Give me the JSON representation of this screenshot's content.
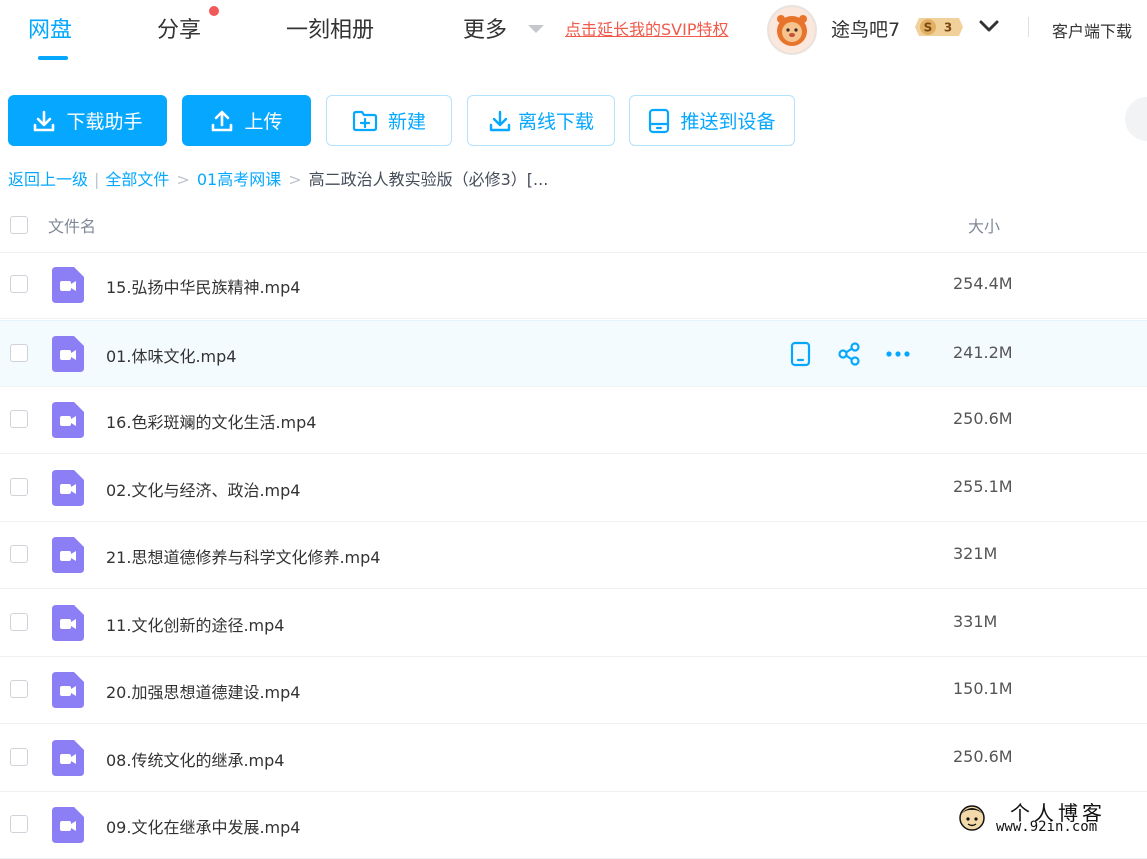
{
  "nav": {
    "tabs": [
      "网盘",
      "分享",
      "一刻相册",
      "更多"
    ],
    "svip_promo": "点击延长我的SVIP特权",
    "username": "途鸟吧7",
    "svip_level": "3",
    "svip_letter": "S",
    "client_download": "客户端下载"
  },
  "toolbar": {
    "download_helper": "下载助手",
    "upload": "上传",
    "new": "新建",
    "offline_download": "离线下载",
    "push_to_device": "推送到设备"
  },
  "breadcrumb": {
    "back": "返回上一级",
    "all_files": "全部文件",
    "folder1": "01高考网课",
    "current": "高二政治人教实验版（必修3）[..."
  },
  "list": {
    "header_name": "文件名",
    "header_size": "大小",
    "files": [
      {
        "name": "15.弘扬中华民族精神.mp4",
        "size": "254.4M"
      },
      {
        "name": "01.体味文化.mp4",
        "size": "241.2M"
      },
      {
        "name": "16.色彩斑斓的文化生活.mp4",
        "size": "250.6M"
      },
      {
        "name": "02.文化与经济、政治.mp4",
        "size": "255.1M"
      },
      {
        "name": "21.思想道德修养与科学文化修养.mp4",
        "size": "321M"
      },
      {
        "name": "11.文化创新的途径.mp4",
        "size": "331M"
      },
      {
        "name": "20.加强思想道德建设.mp4",
        "size": "150.1M"
      },
      {
        "name": "08.传统文化的继承.mp4",
        "size": "250.6M"
      },
      {
        "name": "09.文化在继承中发展.mp4",
        "size": ""
      }
    ]
  },
  "watermark": {
    "title": "个人博客",
    "url": "www.92in.com"
  },
  "colors": {
    "accent": "#06a7ff",
    "promo": "#f05a4a",
    "video_icon": "#8c7ff5",
    "hover_row": "#f4fbff"
  }
}
